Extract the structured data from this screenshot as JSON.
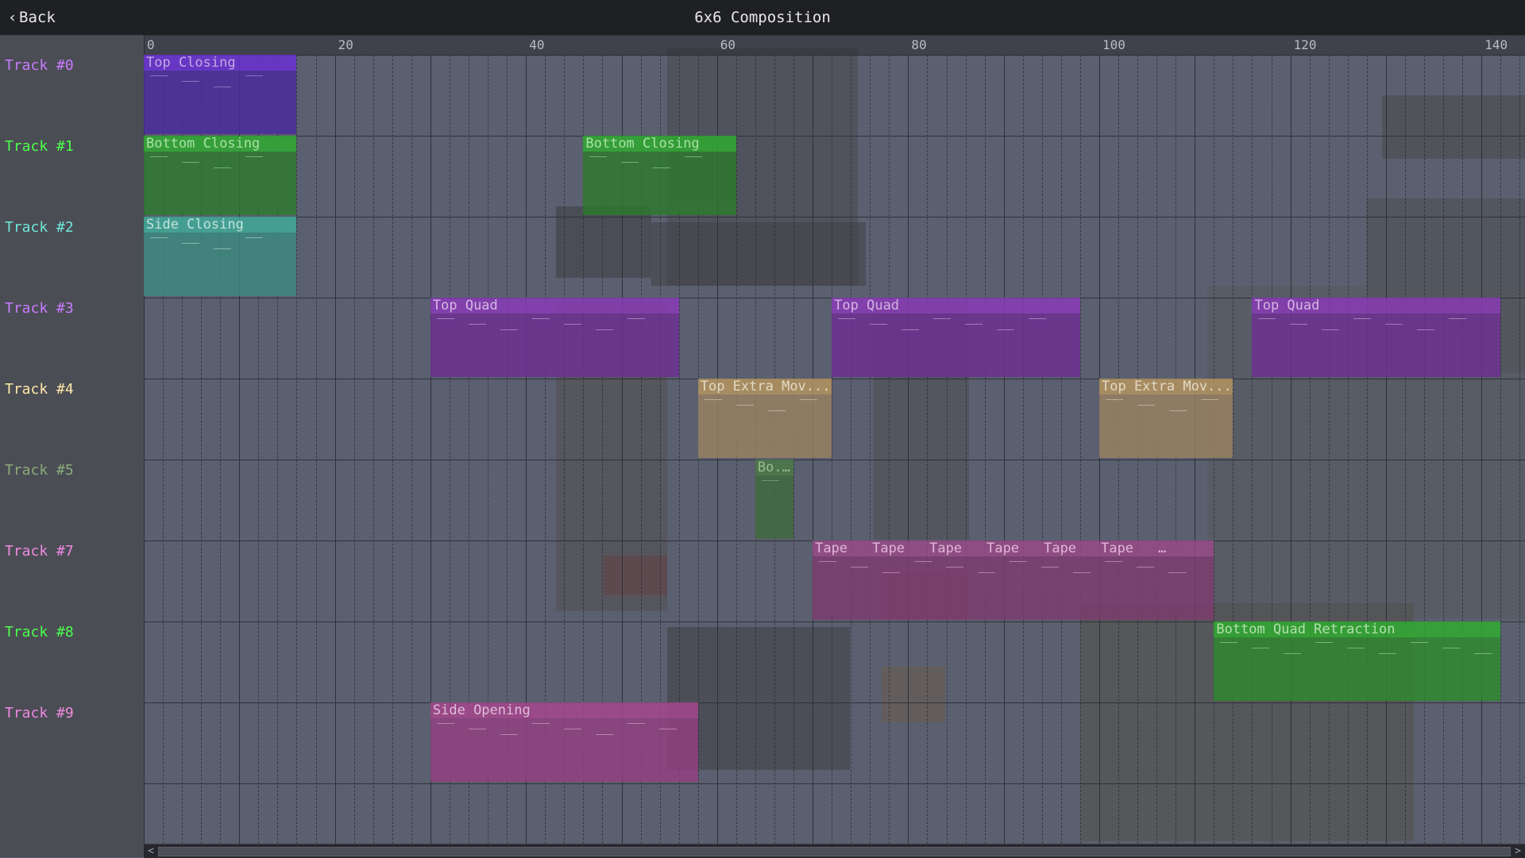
{
  "app": {
    "title": "6x6 Composition",
    "back_label": "Back"
  },
  "timeline": {
    "start": 0,
    "end": 145,
    "major_step": 10,
    "tick_labels": [
      "0",
      "20",
      "40",
      "60",
      "80",
      "100",
      "120",
      "140"
    ],
    "tick_values": [
      0,
      20,
      40,
      60,
      80,
      100,
      120,
      140
    ]
  },
  "tracks": [
    {
      "label": "Track #0",
      "color": "#c87cff"
    },
    {
      "label": "Track #1",
      "color": "#4cff4c"
    },
    {
      "label": "Track #2",
      "color": "#6fe8d8"
    },
    {
      "label": "Track #3",
      "color": "#c87cff"
    },
    {
      "label": "Track #4",
      "color": "#ffe8a8"
    },
    {
      "label": "Track #5",
      "color": "#8aaa7a"
    },
    {
      "label": "Track #7",
      "color": "#f08ae0"
    },
    {
      "label": "Track #8",
      "color": "#4cff4c"
    },
    {
      "label": "Track #9",
      "color": "#f08ae0"
    }
  ],
  "clips": [
    {
      "track": 0,
      "start": 0,
      "end": 16,
      "label": "Top Closing",
      "header": "#6a2fd6",
      "body": "#4a2a9c",
      "text": "#d8b8ff"
    },
    {
      "track": 1,
      "start": 0,
      "end": 16,
      "label": "Bottom Closing",
      "header": "#2fae2f",
      "body": "#2d7a2d",
      "text": "#b8ffb0"
    },
    {
      "track": 1,
      "start": 46,
      "end": 62,
      "label": "Bottom Closing",
      "header": "#2fae2f",
      "body": "#2d7a2d",
      "text": "#b8ffb0"
    },
    {
      "track": 2,
      "start": 0,
      "end": 16,
      "label": "Side Closing",
      "header": "#3fae9a",
      "body": "#3d8a80",
      "text": "#d8fff4"
    },
    {
      "track": 3,
      "start": 30,
      "end": 56,
      "label": "Top Quad",
      "header": "#8a3ab8",
      "body": "#6e2f94",
      "text": "#f0c8ff"
    },
    {
      "track": 3,
      "start": 72,
      "end": 98,
      "label": "Top Quad",
      "header": "#8a3ab8",
      "body": "#6e2f94",
      "text": "#f0c8ff"
    },
    {
      "track": 3,
      "start": 116,
      "end": 142,
      "label": "Top Quad",
      "header": "#8a3ab8",
      "body": "#6e2f94",
      "text": "#f0c8ff"
    },
    {
      "track": 4,
      "start": 58,
      "end": 72,
      "label": "Top Extra Mov...",
      "header": "#b89660",
      "body": "#9a8262",
      "text": "#fff4d8"
    },
    {
      "track": 4,
      "start": 100,
      "end": 114,
      "label": "Top Extra Mov...",
      "header": "#b89660",
      "body": "#9a8262",
      "text": "#fff4d8"
    },
    {
      "track": 5,
      "start": 64,
      "end": 68,
      "label": "Bo...",
      "header": "#4a7a46",
      "body": "#3f6a3c",
      "text": "#a8d098"
    },
    {
      "track": 6,
      "start": 70,
      "end": 112,
      "label": "Tape",
      "segments": [
        "Tape",
        "Tape",
        "Tape",
        "Tape",
        "Tape",
        "Tape",
        "Tape"
      ],
      "header": "#9a4a88",
      "body": "#7e3c70",
      "text": "#ffc8f0"
    },
    {
      "track": 7,
      "start": 112,
      "end": 142,
      "label": "Bottom Quad Retraction",
      "header": "#2fae2f",
      "body": "#2d8a2d",
      "text": "#c8ffc0"
    },
    {
      "track": 8,
      "start": 30,
      "end": 58,
      "label": "Side Opening",
      "header": "#a8468e",
      "body": "#944080",
      "text": "#ffd0f0"
    }
  ]
}
